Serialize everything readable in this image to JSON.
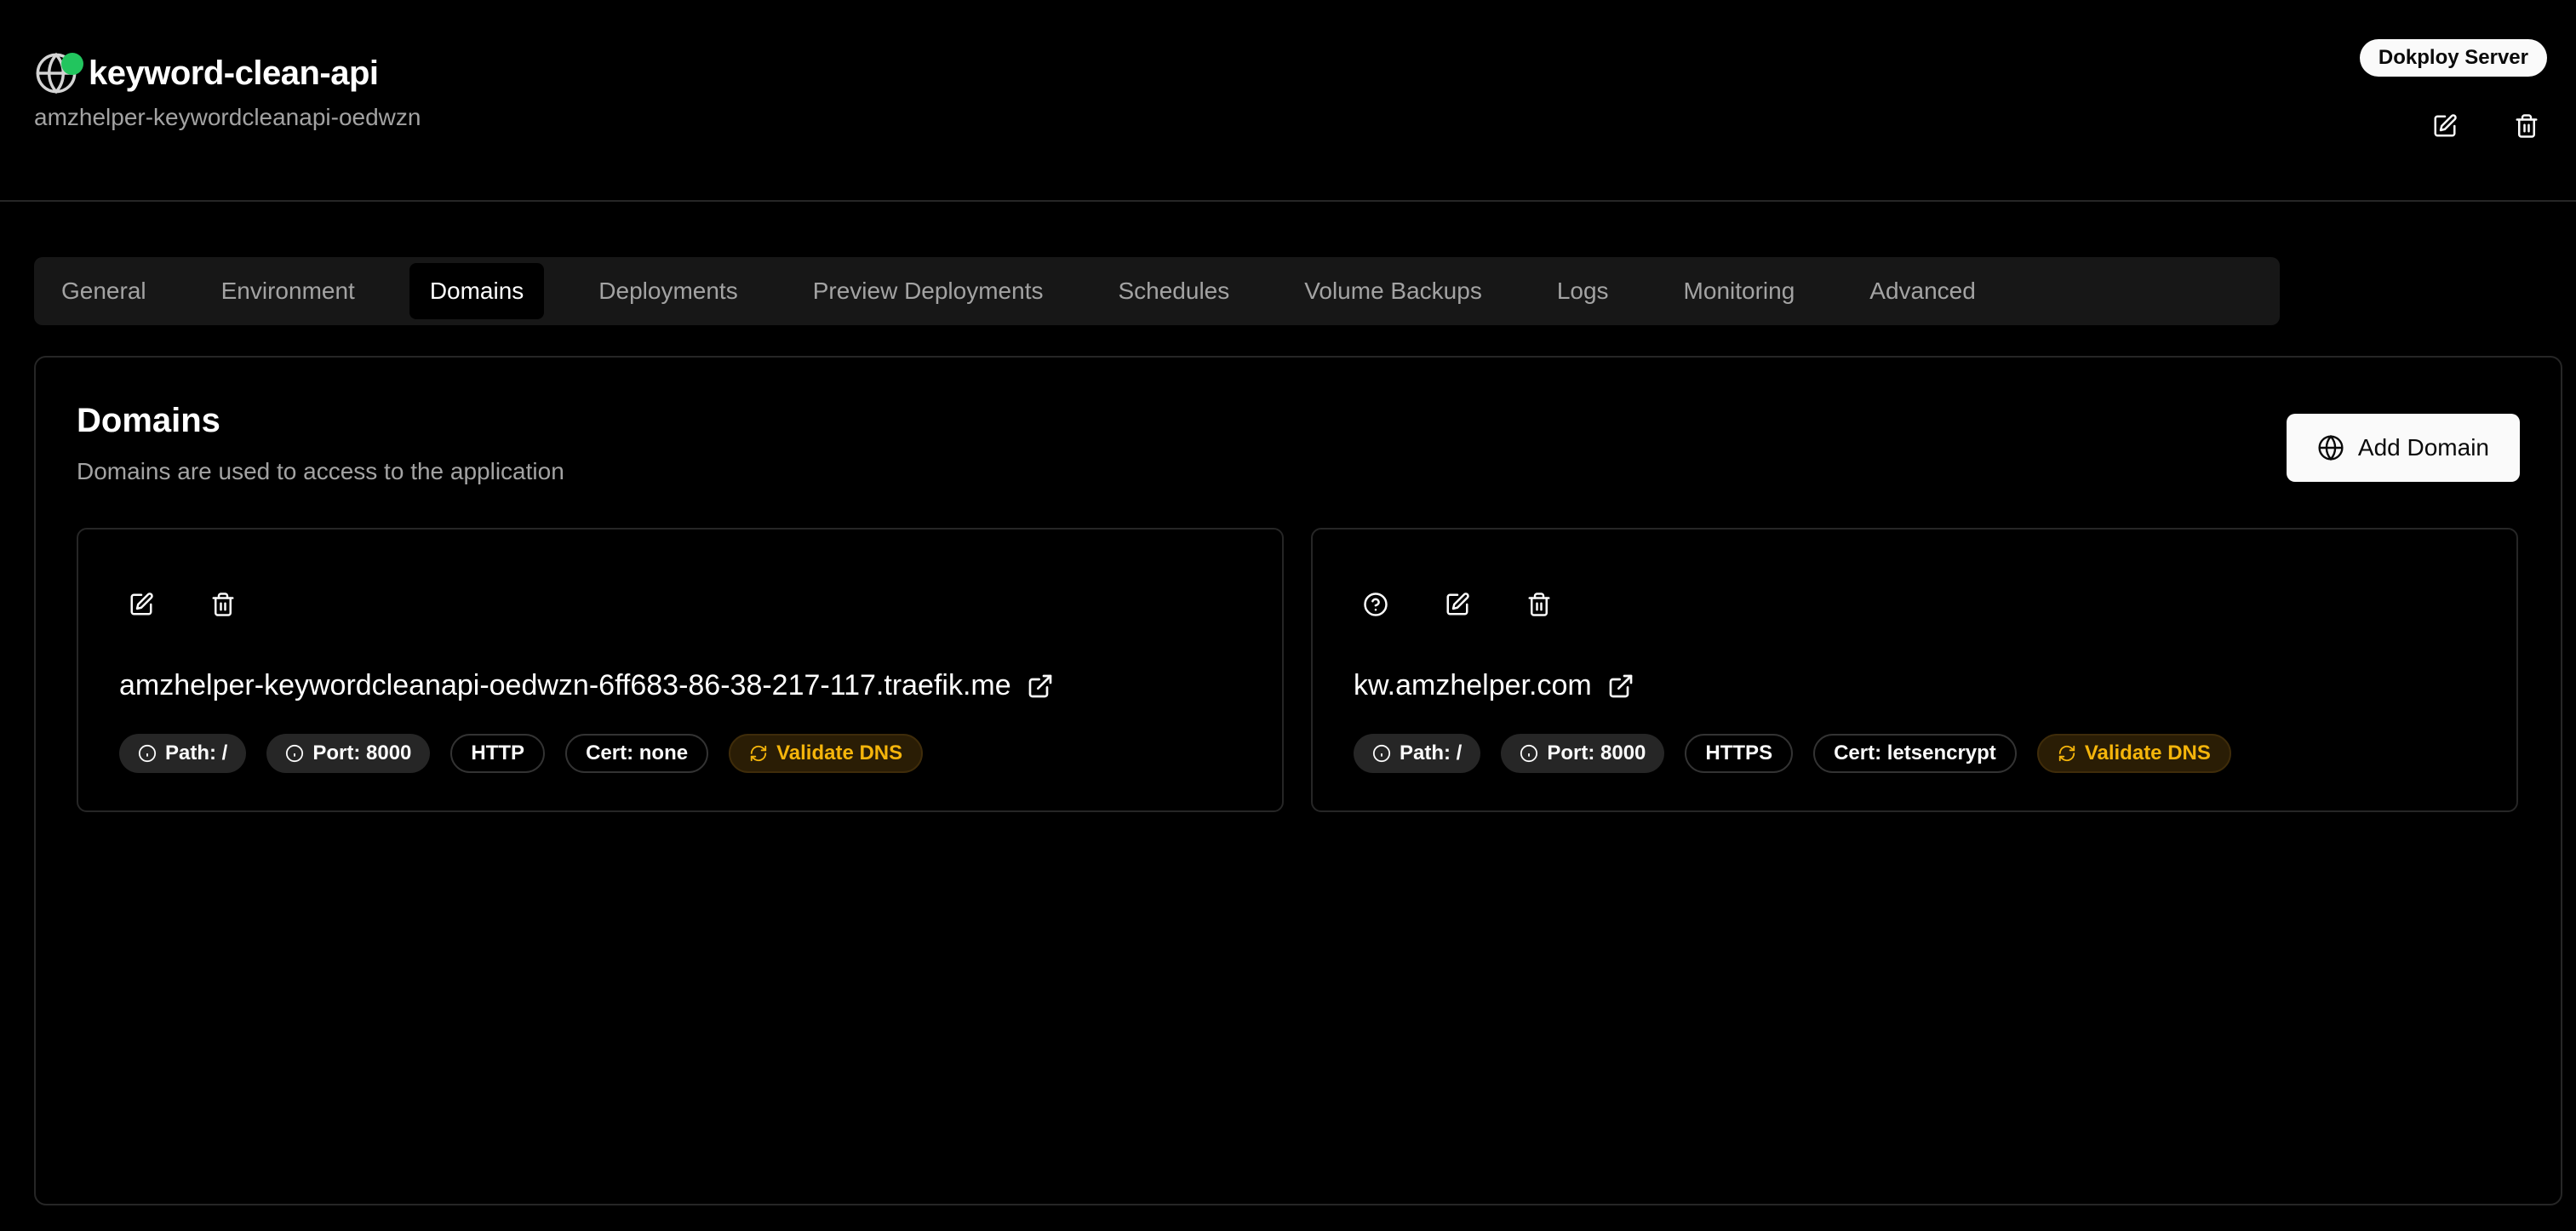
{
  "header": {
    "title": "keyword-clean-api",
    "subtitle": "amzhelper-keywordcleanapi-oedwzn",
    "server_badge": "Dokploy Server",
    "status_color": "#22c55e"
  },
  "tabs": [
    {
      "label": "General",
      "active": false
    },
    {
      "label": "Environment",
      "active": false
    },
    {
      "label": "Domains",
      "active": true
    },
    {
      "label": "Deployments",
      "active": false
    },
    {
      "label": "Preview Deployments",
      "active": false
    },
    {
      "label": "Schedules",
      "active": false
    },
    {
      "label": "Volume Backups",
      "active": false
    },
    {
      "label": "Logs",
      "active": false
    },
    {
      "label": "Monitoring",
      "active": false
    },
    {
      "label": "Advanced",
      "active": false
    }
  ],
  "domains_section": {
    "title": "Domains",
    "description": "Domains are used to access to the application",
    "add_button": "Add Domain",
    "domains": [
      {
        "host": "amzhelper-keywordcleanapi-oedwzn-6ff683-86-38-217-117.traefik.me",
        "path": "Path: /",
        "port": "Port: 8000",
        "protocol": "HTTP",
        "cert": "Cert: none",
        "validate": "Validate DNS"
      },
      {
        "host": "kw.amzhelper.com",
        "path": "Path: /",
        "port": "Port: 8000",
        "protocol": "HTTPS",
        "cert": "Cert: letsencrypt",
        "validate": "Validate DNS"
      }
    ]
  },
  "colors": {
    "background": "#000000",
    "accent_warning": "#f5b50b",
    "border": "#262626"
  }
}
